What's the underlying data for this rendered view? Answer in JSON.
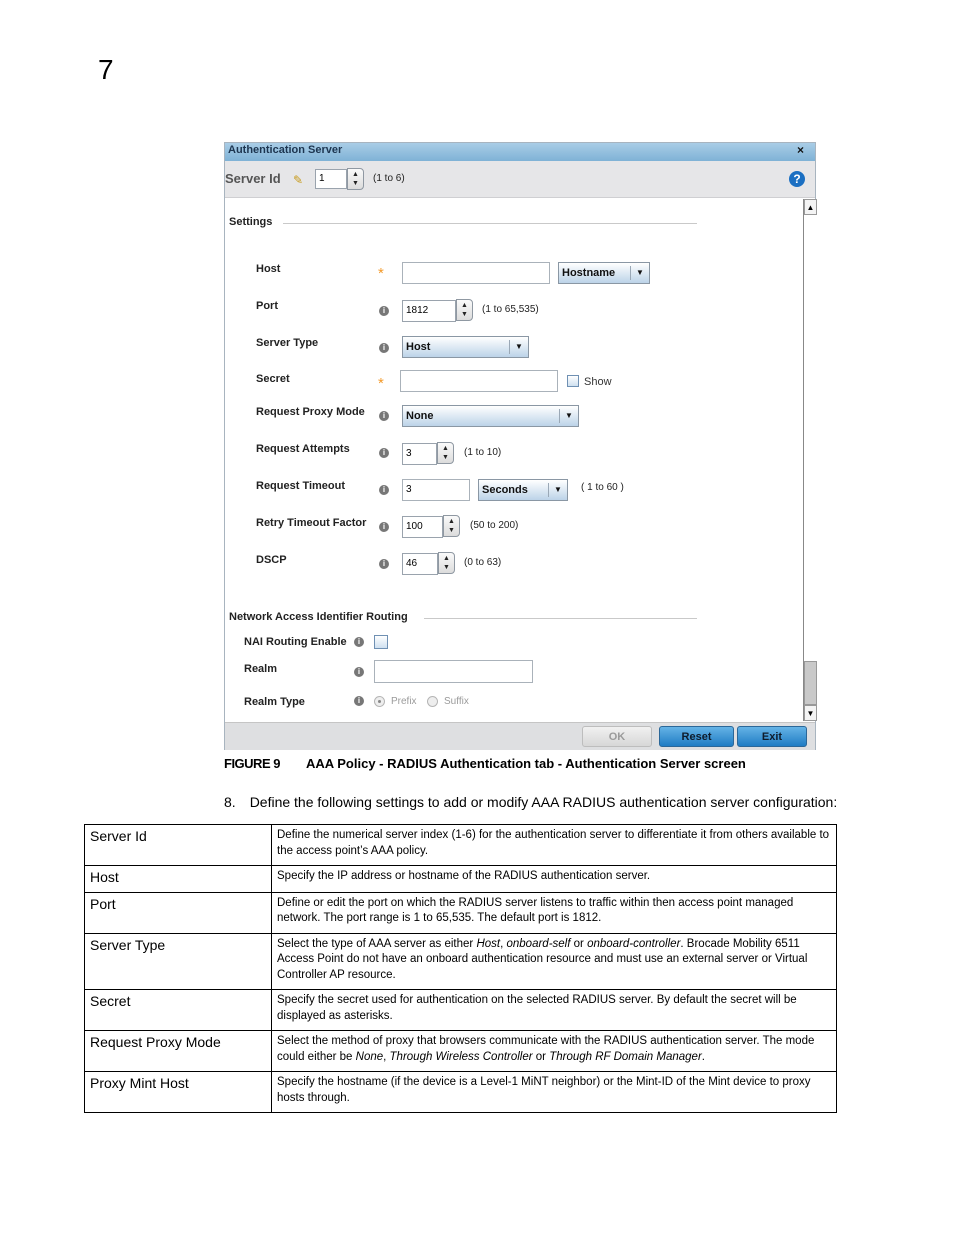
{
  "page": {
    "chapter_number": "7"
  },
  "dialog": {
    "title": "Authentication Server",
    "close_glyph": "×",
    "server_id": {
      "label": "Server Id",
      "value": "1",
      "range": "(1 to 6)",
      "edit_icon": "pencil-icon",
      "help_icon": "?"
    },
    "settings_section": "Settings",
    "fields": {
      "host": {
        "label": "Host",
        "value": "",
        "required": "*",
        "type_select": "Hostname"
      },
      "port": {
        "label": "Port",
        "value": "1812",
        "range": "(1 to 65,535)"
      },
      "server_type": {
        "label": "Server Type",
        "value": "Host"
      },
      "secret": {
        "label": "Secret",
        "value": "",
        "required": "*",
        "show_label": "Show"
      },
      "request_proxy_mode": {
        "label": "Request Proxy Mode",
        "value": "None"
      },
      "request_attempts": {
        "label": "Request Attempts",
        "value": "3",
        "range": "(1 to 10)"
      },
      "request_timeout": {
        "label": "Request Timeout",
        "value": "3",
        "unit": "Seconds",
        "range": "( 1 to 60 )"
      },
      "retry_timeout_factor": {
        "label": "Retry Timeout Factor",
        "value": "100",
        "range": "(50 to 200)"
      },
      "dscp": {
        "label": "DSCP",
        "value": "46",
        "range": "(0 to 63)"
      }
    },
    "nai_section": "Network Access Identifier Routing",
    "nai": {
      "routing_enable": {
        "label": "NAI Routing Enable",
        "checked": false
      },
      "realm": {
        "label": "Realm",
        "value": ""
      },
      "realm_type": {
        "label": "Realm Type",
        "options": [
          "Prefix",
          "Suffix"
        ],
        "selected": "Prefix"
      }
    },
    "buttons": {
      "ok": "OK",
      "reset": "Reset",
      "exit": "Exit"
    },
    "info_glyph": "i",
    "arrow_down": "▼",
    "arrow_up": "▲"
  },
  "caption": {
    "figure": "FIGURE 9",
    "text": "AAA Policy - RADIUS Authentication tab - Authentication Server screen"
  },
  "step": {
    "number": "8.",
    "text": "Define the following settings to add or modify AAA RADIUS authentication server configuration:"
  },
  "table": {
    "rows": [
      {
        "key": "Server Id",
        "value": "Define the numerical server index (1-6) for the authentication server to differentiate it from others available to the access point’s AAA policy."
      },
      {
        "key": "Host",
        "value": "Specify the IP address or hostname of the RADIUS authentication server."
      },
      {
        "key": "Port",
        "value": "Define or edit the port on which the RADIUS server listens to traffic within then access point managed network. The port range is 1 to 65,535. The default port is 1812."
      },
      {
        "key": "Server Type",
        "value_parts": [
          "Select the type of AAA server as either ",
          "Host",
          ", ",
          "onboard-self",
          " or ",
          "onboard-controller",
          ". Brocade Mobility 6511 Access Point do not have an onboard authentication resource and must use an external server or Virtual Controller AP resource."
        ]
      },
      {
        "key": "Secret",
        "value": "Specify the secret used for authentication on the selected RADIUS server. By default the secret will be displayed as asterisks."
      },
      {
        "key": "Request Proxy Mode",
        "value_parts": [
          "Select the method of proxy that browsers communicate with the RADIUS authentication server. The mode could either be ",
          "None",
          ", ",
          "Through Wireless Controller",
          " or ",
          "Through RF Domain Manager",
          "."
        ]
      },
      {
        "key": "Proxy Mint Host",
        "value": "Specify the hostname (if the device is a Level-1 MiNT neighbor) or the Mint-ID of the Mint device to proxy hosts through."
      }
    ]
  }
}
